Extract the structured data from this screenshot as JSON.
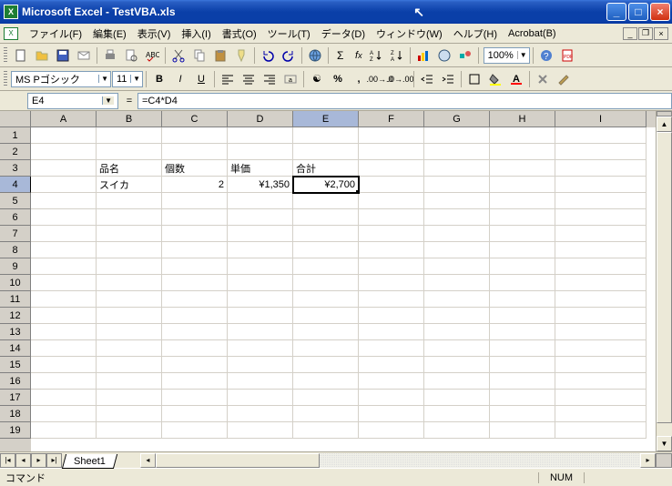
{
  "window": {
    "title": "Microsoft Excel - TestVBA.xls"
  },
  "menu": {
    "file": "ファイル(F)",
    "edit": "編集(E)",
    "view": "表示(V)",
    "insert": "挿入(I)",
    "format": "書式(O)",
    "tools": "ツール(T)",
    "data": "データ(D)",
    "window": "ウィンドウ(W)",
    "help": "ヘルプ(H)",
    "acrobat": "Acrobat(B)"
  },
  "toolbar": {
    "zoom": "100%"
  },
  "format": {
    "font": "MS Pゴシック",
    "size": "11"
  },
  "formula": {
    "name": "E4",
    "value": "=C4*D4"
  },
  "columns": [
    "A",
    "B",
    "C",
    "D",
    "E",
    "F",
    "G",
    "H",
    "I"
  ],
  "rows_visible": 19,
  "selected": {
    "row": 4,
    "col": "E"
  },
  "cells": {
    "B3": "品名",
    "C3": "個数",
    "D3": "単価",
    "E3": "合計",
    "B4": "スイカ",
    "C4": "2",
    "D4": "¥1,350",
    "E4": "¥2,700"
  },
  "tabs": {
    "sheet1": "Sheet1"
  },
  "status": {
    "mode": "コマンド",
    "num": "NUM"
  }
}
